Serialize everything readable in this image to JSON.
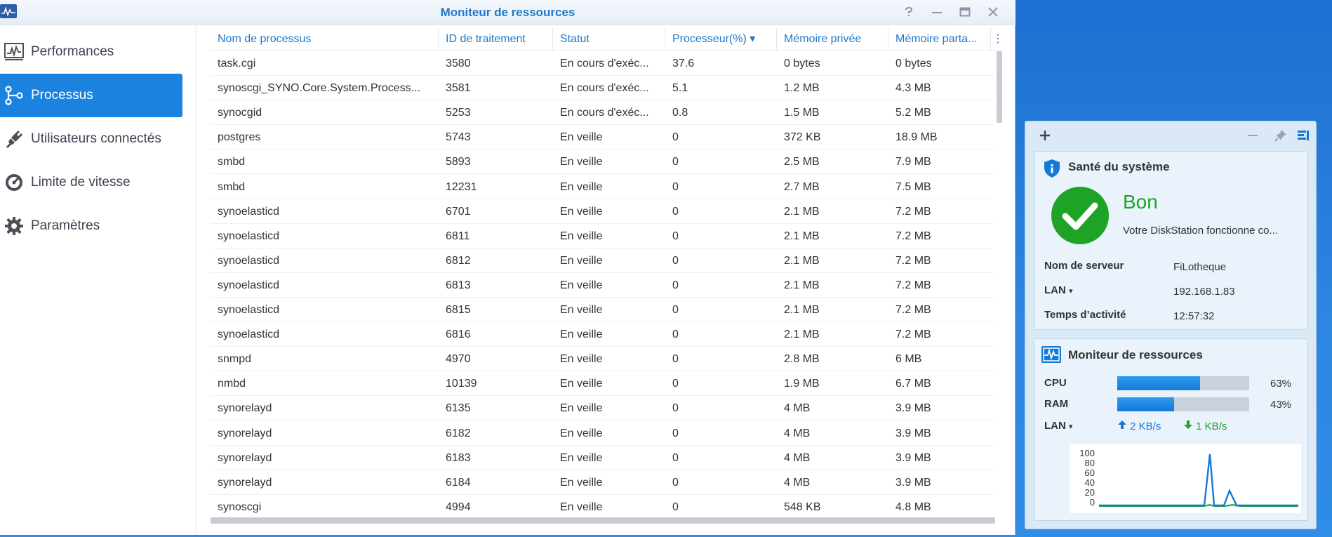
{
  "window": {
    "title": "Moniteur de ressources",
    "controls": [
      "?",
      "—",
      "▭",
      "✕"
    ]
  },
  "sidebar": {
    "items": [
      {
        "label": "Performances",
        "icon": "performance-chart-icon",
        "active": false
      },
      {
        "label": "Processus",
        "icon": "process-branch-icon",
        "active": true
      },
      {
        "label": "Utilisateurs connectés",
        "icon": "plug-icon",
        "active": false
      },
      {
        "label": "Limite de vitesse",
        "icon": "speedometer-icon",
        "active": false
      },
      {
        "label": "Paramètres",
        "icon": "gear-icon",
        "active": false
      }
    ]
  },
  "table": {
    "columns": [
      "Nom de processus",
      "ID de traitement",
      "Statut",
      "Processeur(%)",
      "Mémoire privée",
      "Mémoire parta..."
    ],
    "sort_indicator": "▾",
    "rows": [
      [
        "task.cgi",
        "3580",
        "En cours d'exéc...",
        "37.6",
        "0 bytes",
        "0 bytes"
      ],
      [
        "synoscgi_SYNO.Core.System.Process...",
        "3581",
        "En cours d'exéc...",
        "5.1",
        "1.2 MB",
        "4.3 MB"
      ],
      [
        "synocgid",
        "5253",
        "En cours d'exéc...",
        "0.8",
        "1.5 MB",
        "5.2 MB"
      ],
      [
        "postgres",
        "5743",
        "En veille",
        "0",
        "372 KB",
        "18.9 MB"
      ],
      [
        "smbd",
        "5893",
        "En veille",
        "0",
        "2.5 MB",
        "7.9 MB"
      ],
      [
        "smbd",
        "12231",
        "En veille",
        "0",
        "2.7 MB",
        "7.5 MB"
      ],
      [
        "synoelasticd",
        "6701",
        "En veille",
        "0",
        "2.1 MB",
        "7.2 MB"
      ],
      [
        "synoelasticd",
        "6811",
        "En veille",
        "0",
        "2.1 MB",
        "7.2 MB"
      ],
      [
        "synoelasticd",
        "6812",
        "En veille",
        "0",
        "2.1 MB",
        "7.2 MB"
      ],
      [
        "synoelasticd",
        "6813",
        "En veille",
        "0",
        "2.1 MB",
        "7.2 MB"
      ],
      [
        "synoelasticd",
        "6815",
        "En veille",
        "0",
        "2.1 MB",
        "7.2 MB"
      ],
      [
        "synoelasticd",
        "6816",
        "En veille",
        "0",
        "2.1 MB",
        "7.2 MB"
      ],
      [
        "snmpd",
        "4970",
        "En veille",
        "0",
        "2.8 MB",
        "6 MB"
      ],
      [
        "nmbd",
        "10139",
        "En veille",
        "0",
        "1.9 MB",
        "6.7 MB"
      ],
      [
        "synorelayd",
        "6135",
        "En veille",
        "0",
        "4 MB",
        "3.9 MB"
      ],
      [
        "synorelayd",
        "6182",
        "En veille",
        "0",
        "4 MB",
        "3.9 MB"
      ],
      [
        "synorelayd",
        "6183",
        "En veille",
        "0",
        "4 MB",
        "3.9 MB"
      ],
      [
        "synorelayd",
        "6184",
        "En veille",
        "0",
        "4 MB",
        "3.9 MB"
      ],
      [
        "synoscgi",
        "4994",
        "En veille",
        "0",
        "548 KB",
        "4.8 MB"
      ]
    ]
  },
  "widgets": {
    "health": {
      "title": "Santé du système",
      "status": "Bon",
      "message": "Votre DiskStation fonctionne co...",
      "server_label": "Nom de serveur",
      "server_value": "FiLotheque",
      "lan_label": "LAN",
      "lan_value": "192.168.1.83",
      "uptime_label": "Temps d’activité",
      "uptime_value": "12:57:32"
    },
    "monitor": {
      "title": "Moniteur de ressources",
      "cpu_label": "CPU",
      "cpu_value": "63%",
      "cpu_fraction": 0.63,
      "ram_label": "RAM",
      "ram_value": "43%",
      "ram_fraction": 0.43,
      "lan_label": "LAN",
      "upload": "2 KB/s",
      "download": "1 KB/s",
      "y_ticks": [
        "100",
        "80",
        "60",
        "40",
        "20",
        "0"
      ]
    }
  },
  "colors": {
    "accent": "#1b82e0",
    "header_text": "#1f78c8",
    "ok_green": "#1fa327",
    "upload_blue": "#1479d8",
    "download_green": "#1fa327"
  }
}
